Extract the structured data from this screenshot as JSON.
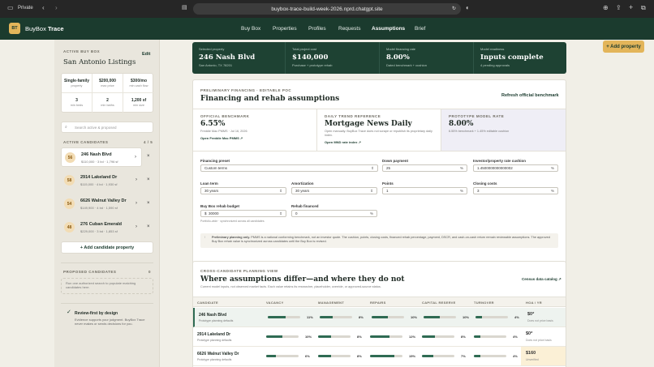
{
  "browser": {
    "private_label": "Private",
    "url": "buybox-trace-build-week-2026.nprd.chatgpt.site"
  },
  "app": {
    "logo": "BT",
    "name_1": "BuyBox",
    "name_2": "Trace",
    "nav": [
      "Buy Box",
      "Properties",
      "Profiles",
      "Requests",
      "Assumptions",
      "Brief"
    ],
    "add_property": "+ Add property"
  },
  "sidebar": {
    "active_label": "ACTIVE BUY BOX",
    "edit": "Edit",
    "buybox_name": "San Antonio Listings",
    "stats": [
      {
        "value": "Single-family",
        "label": "property"
      },
      {
        "value": "$200,000",
        "label": "max price"
      },
      {
        "value": "$300/mo",
        "label": "min cash flow"
      },
      {
        "value": "3",
        "label": "min beds"
      },
      {
        "value": "2",
        "label": "min baths"
      },
      {
        "value": "1,200 sf",
        "label": "min size"
      }
    ],
    "search_placeholder": "Search active & proposed",
    "candidates_label": "ACTIVE CANDIDATES",
    "candidates_count": "4 / 5",
    "candidates": [
      {
        "score": "56",
        "name": "246 Nash Blvd",
        "meta": "$110,000 · 3 bd · 1,796 sf"
      },
      {
        "score": "58",
        "name": "2914 Lakeland Dr",
        "meta": "$115,000 · 4 bd · 1,930 sf"
      },
      {
        "score": "54",
        "name": "6626 Walnut Valley Dr",
        "meta": "$149,900 · 4 bd · 1,590 sf"
      },
      {
        "score": "48",
        "name": "276 Cuban Emerald",
        "meta": "$229,000 · 3 bd · 1,853 sf"
      }
    ],
    "add_candidate": "+ Add candidate property",
    "proposed_label": "PROPOSED CANDIDATES",
    "proposed_count": "0",
    "proposed_text": "Run one authorized search to populate matching candidates here.",
    "review_title": "Review-first by design",
    "review_text": "Evidence supports your judgment. BuyBox Trace never makes or sends decisions for you."
  },
  "summary": [
    {
      "label": "Selected property",
      "value": "246 Nash Blvd",
      "sub": "San Antonio, TX 78201"
    },
    {
      "label": "Total project cost",
      "value": "$140,000",
      "sub": "Purchase + prototype rehab"
    },
    {
      "label": "Model financing rate",
      "value": "8.00%",
      "sub": "Dated benchmark + cushion"
    },
    {
      "label": "Model readiness",
      "value": "Inputs complete",
      "sub": "4 pending approvals"
    }
  ],
  "financing": {
    "eyebrow": "PRELIMINARY FINANCING · EDITABLE POC",
    "title": "Financing and rehab assumptions",
    "refresh": "Refresh official benchmark",
    "benchmarks": [
      {
        "label": "OFFICIAL BENCHMARK",
        "value": "6.55%",
        "sub": "Freddie Mac PMMS · Jul 16, 2026",
        "link": "Open Freddie Mac PMMS ↗"
      },
      {
        "label": "DAILY TREND REFERENCE",
        "value": "Mortgage News Daily",
        "sub": "Open manually. BuyBox Trace does not scrape or republish its proprietary daily index.",
        "link": "Open MND rate index ↗"
      },
      {
        "label": "PROTOTYPE MODEL RATE",
        "value": "8.00%",
        "sub": "6.55% benchmark + 1.45% editable cushion",
        "link": ""
      }
    ],
    "fields": {
      "preset_label": "Financing preset",
      "preset_value": "Custom terms",
      "down_label": "Down payment",
      "down_value": "25",
      "down_unit": "%",
      "cushion_label": "Investor/property rate cushion",
      "cushion_value": "1.4500000000000002",
      "cushion_unit": "%",
      "loan_label": "Loan term",
      "loan_value": "30 years",
      "amort_label": "Amortization",
      "amort_value": "30 years",
      "points_label": "Points",
      "points_value": "1",
      "points_unit": "%",
      "closing_label": "Closing costs",
      "closing_value": "3",
      "closing_unit": "%",
      "rehab_label": "Buy Box rehab budget",
      "rehab_prefix": "$",
      "rehab_value": "30000",
      "rehab_fin_label": "Rehab financed",
      "rehab_fin_value": "0",
      "rehab_fin_unit": "%",
      "rehab_note": "Portfolio-wide · synchronized across all candidates"
    },
    "notice_bold": "Preliminary planning only.",
    "notice_text": " PMMS is a national conforming benchmark, not an investor quote. The cushion, points, closing costs, financed rehab percentage, payment, DSCR, and cash-on-cash return remain reviewable assumptions. The approved Buy Box rehab value is synchronized across candidates until the Buy Box is revised."
  },
  "compare": {
    "eyebrow": "CROSS-CANDIDATE PLANNING VIEW",
    "title": "Where assumptions differ—and where they do not",
    "subtitle": "Current model inputs, not observed market facts. Each value retains its researcher, placeholder, override, or approved-source status.",
    "link": "Census data catalog ↗",
    "columns": [
      "CANDIDATE",
      "VACANCY",
      "MANAGEMENT",
      "REPAIRS",
      "CAPITAL RESERVE",
      "TURNOVER",
      "HOA / YR"
    ],
    "rows": [
      {
        "name": "246 Nash Blvd",
        "sub": "Prototype planning defaults",
        "vals": [
          "11%",
          "8%",
          "10%",
          "10%",
          "4%"
        ],
        "fills": [
          0.55,
          0.4,
          0.5,
          0.5,
          0.2
        ],
        "hoa": "$0*",
        "hoa_sub": "Does not price basis"
      },
      {
        "name": "2914 Lakeland Dr",
        "sub": "Prototype planning defaults",
        "vals": [
          "10%",
          "8%",
          "12%",
          "8%",
          "4%"
        ],
        "fills": [
          0.5,
          0.4,
          0.6,
          0.4,
          0.2
        ],
        "hoa": "$0*",
        "hoa_sub": "Does not price basis"
      },
      {
        "name": "6626 Walnut Valley Dr",
        "sub": "Prototype planning defaults",
        "vals": [
          "6%",
          "8%",
          "15%",
          "7%",
          "4%"
        ],
        "fills": [
          0.3,
          0.4,
          0.75,
          0.35,
          0.2
        ],
        "hoa": "$160",
        "hoa_sub": "Unverified"
      }
    ]
  }
}
